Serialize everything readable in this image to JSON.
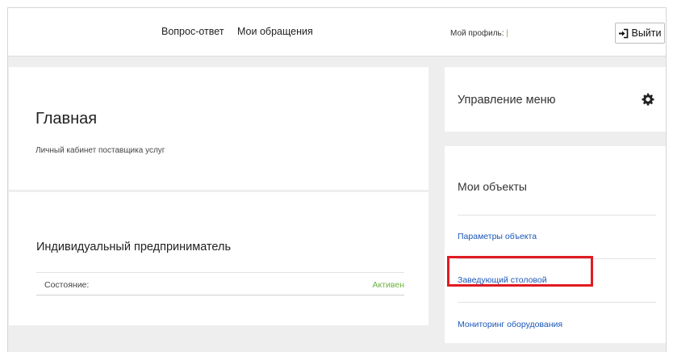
{
  "header": {
    "nav": [
      "Вопрос-ответ",
      "Мои обращения"
    ],
    "profile_label": "Мой профиль:",
    "profile_value": "|",
    "logout_label": "Выйти"
  },
  "main": {
    "title": "Главная",
    "subtitle": "Личный кабинет поставщика услуг"
  },
  "entrepreneur": {
    "title": "Индивидуальный предприниматель",
    "status_label": "Состояние:",
    "status_value": "Активен"
  },
  "menu_card": {
    "title": "Управление меню",
    "icon": "gear-icon"
  },
  "objects": {
    "title": "Мои объекты",
    "links": [
      "Параметры объекта",
      "Заведующий столовой",
      "Мониторинг оборудования"
    ]
  },
  "colors": {
    "accent_green": "#6cb33f",
    "link_blue": "#1a56b8",
    "highlight_red": "#e01b22",
    "background": "#eeeeee"
  }
}
